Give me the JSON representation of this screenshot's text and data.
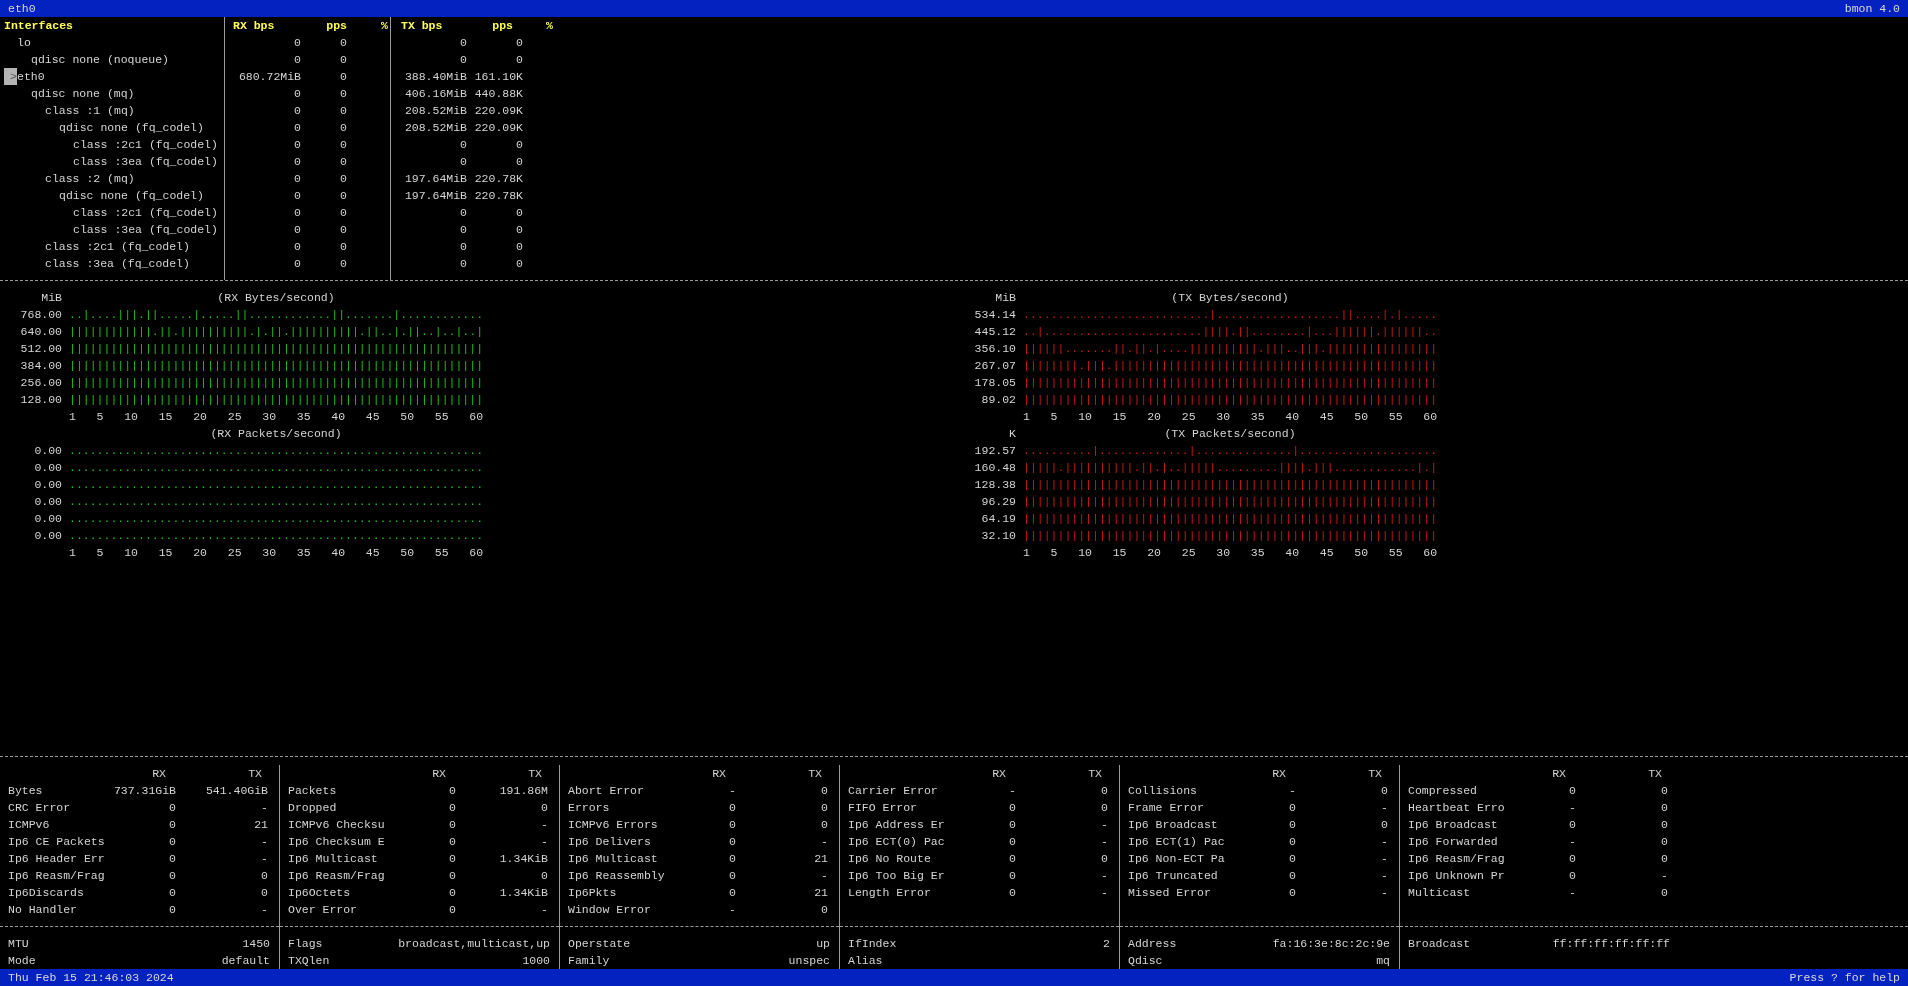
{
  "title_bar": {
    "left": "eth0",
    "right": "bmon 4.0"
  },
  "interfaces": {
    "columns": [
      "Interfaces",
      "RX bps",
      "pps",
      "%",
      "TX bps",
      "pps",
      "%"
    ],
    "cursor": ">",
    "rows": [
      {
        "name": "lo",
        "rx_bps": "0",
        "rx_pps": "0",
        "tx_bps": "0",
        "tx_pps": "0",
        "selected": false,
        "children": [
          {
            "name": "qdisc none (noqueue)",
            "rx_bps": "0",
            "rx_pps": "0",
            "tx_bps": "0",
            "tx_pps": "0"
          }
        ]
      },
      {
        "name": "eth0",
        "rx_bps": "680.72MiB",
        "rx_pps": "0",
        "tx_bps": "388.40MiB",
        "tx_pps": "161.10K",
        "selected": true,
        "children": [
          {
            "name": "qdisc none (mq)",
            "rx_bps": "0",
            "rx_pps": "0",
            "tx_bps": "406.16MiB",
            "tx_pps": "440.88K",
            "children": [
              {
                "name": "class :1 (mq)",
                "rx_bps": "0",
                "rx_pps": "0",
                "tx_bps": "208.52MiB",
                "tx_pps": "220.09K",
                "children": [
                  {
                    "name": "qdisc none (fq_codel)",
                    "rx_bps": "0",
                    "rx_pps": "0",
                    "tx_bps": "208.52MiB",
                    "tx_pps": "220.09K",
                    "children": [
                      {
                        "name": "class :2c1 (fq_codel)",
                        "rx_bps": "0",
                        "rx_pps": "0",
                        "tx_bps": "0",
                        "tx_pps": "0"
                      },
                      {
                        "name": "class :3ea (fq_codel)",
                        "rx_bps": "0",
                        "rx_pps": "0",
                        "tx_bps": "0",
                        "tx_pps": "0"
                      }
                    ]
                  }
                ]
              },
              {
                "name": "class :2 (mq)",
                "rx_bps": "0",
                "rx_pps": "0",
                "tx_bps": "197.64MiB",
                "tx_pps": "220.78K",
                "children": [
                  {
                    "name": "qdisc none (fq_codel)",
                    "rx_bps": "0",
                    "rx_pps": "0",
                    "tx_bps": "197.64MiB",
                    "tx_pps": "220.78K",
                    "children": [
                      {
                        "name": "class :2c1 (fq_codel)",
                        "rx_bps": "0",
                        "rx_pps": "0",
                        "tx_bps": "0",
                        "tx_pps": "0"
                      },
                      {
                        "name": "class :3ea (fq_codel)",
                        "rx_bps": "0",
                        "rx_pps": "0",
                        "tx_bps": "0",
                        "tx_pps": "0"
                      }
                    ]
                  }
                ]
              },
              {
                "name": "class :2c1 (fq_codel)",
                "rx_bps": "0",
                "rx_pps": "0",
                "tx_bps": "0",
                "tx_pps": "0"
              },
              {
                "name": "class :3ea (fq_codel)",
                "rx_bps": "0",
                "rx_pps": "0",
                "tx_bps": "0",
                "tx_pps": "0"
              }
            ]
          }
        ]
      }
    ]
  },
  "graph_columns": [
    [
      {
        "unit": "MiB",
        "title": "(RX Bytes/second)",
        "color": "#1ec01e",
        "axis": "1   5   10   15   20   25   30   35   40   45   50   55   60",
        "rows": [
          {
            "label": "768.00",
            "pattern": "..|....|||.||.....|.....||............||.......|............"
          },
          {
            "label": "640.00",
            "pattern": "||||||||||||.||.||||||||||.|.||.||||||||||.||..|.||..|..|..|"
          },
          {
            "label": "512.00",
            "pattern": "||||||||||||||||||||||||||||||||||||||||||||||||||||||||||||"
          },
          {
            "label": "384.00",
            "pattern": "||||||||||||||||||||||||||||||||||||||||||||||||||||||||||||"
          },
          {
            "label": "256.00",
            "pattern": "||||||||||||||||||||||||||||||||||||||||||||||||||||||||||||"
          },
          {
            "label": "128.00",
            "pattern": "||||||||||||||||||||||||||||||||||||||||||||||||||||||||||||"
          }
        ]
      },
      {
        "title": "(RX Packets/second)",
        "color": "#1ec01e",
        "axis": "1   5   10   15   20   25   30   35   40   45   50   55   60",
        "rows": [
          {
            "label": "0.00",
            "pattern": "............................................................"
          },
          {
            "label": "0.00",
            "pattern": "............................................................"
          },
          {
            "label": "0.00",
            "pattern": "............................................................"
          },
          {
            "label": "0.00",
            "pattern": "............................................................"
          },
          {
            "label": "0.00",
            "pattern": "............................................................"
          },
          {
            "label": "0.00",
            "pattern": "............................................................"
          }
        ]
      }
    ],
    [
      {
        "unit": "MiB",
        "title": "(TX Bytes/second)",
        "color": "#d01818",
        "axis": "1   5   10   15   20   25   30   35   40   45   50   55   60",
        "rows": [
          {
            "label": "534.14",
            "pattern": "...........................|..................||....|.|....."
          },
          {
            "label": "445.12",
            "pattern": "..|.......................||||.||........|...||||||.||||||.."
          },
          {
            "label": "356.10",
            "pattern": "||||||.......||.||.|....||||||||||.|||..|||.||||||||||||||||"
          },
          {
            "label": "267.07",
            "pattern": "||||||||.|||.|||||||||||||||||||||||||||||||||||||||||||||||"
          },
          {
            "label": "178.05",
            "pattern": "||||||||||||||||||||||||||||||||||||||||||||||||||||||||||||"
          },
          {
            "label": "89.02",
            "pattern": "||||||||||||||||||||||||||||||||||||||||||||||||||||||||||||"
          }
        ]
      },
      {
        "unit": "K",
        "title": "(TX Packets/second)",
        "color": "#d01818",
        "axis": "1   5   10   15   20   25   30   35   40   45   50   55   60",
        "rows": [
          {
            "label": "192.57",
            "pattern": "..........|.............|..............|...................."
          },
          {
            "label": "160.48",
            "pattern": "|||||.||||||||||.||.|..|||||.........||||.|||............|.|"
          },
          {
            "label": "128.38",
            "pattern": "||||||||||||||||||||||||||||||||||||||||||||||||||||||||||||"
          },
          {
            "label": "96.29",
            "pattern": "||||||||||||||||||||||||||||||||||||||||||||||||||||||||||||"
          },
          {
            "label": "64.19",
            "pattern": "||||||||||||||||||||||||||||||||||||||||||||||||||||||||||||"
          },
          {
            "label": "32.10",
            "pattern": "||||||||||||||||||||||||||||||||||||||||||||||||||||||||||||"
          }
        ]
      }
    ]
  ],
  "stats": [
    {
      "rx_header": "RX",
      "tx_header": "TX",
      "rows": [
        {
          "label": "Bytes",
          "rx": "737.31GiB",
          "tx": "541.40GiB"
        },
        {
          "label": "CRC Error",
          "rx": "0",
          "tx": "-"
        },
        {
          "label": "ICMPv6",
          "rx": "0",
          "tx": "21"
        },
        {
          "label": "Ip6 CE Packets",
          "rx": "0",
          "tx": "-"
        },
        {
          "label": "Ip6 Header Err",
          "rx": "0",
          "tx": "-"
        },
        {
          "label": "Ip6 Reasm/Frag",
          "rx": "0",
          "tx": "0"
        },
        {
          "label": "Ip6Discards",
          "rx": "0",
          "tx": "0"
        },
        {
          "label": "No Handler",
          "rx": "0",
          "tx": "-"
        }
      ]
    },
    {
      "rx_header": "RX",
      "tx_header": "TX",
      "rows": [
        {
          "label": "Packets",
          "rx": "0",
          "tx": "191.86M"
        },
        {
          "label": "Dropped",
          "rx": "0",
          "tx": "0"
        },
        {
          "label": "ICMPv6 Checksu",
          "rx": "0",
          "tx": "-"
        },
        {
          "label": "Ip6 Checksum E",
          "rx": "0",
          "tx": "-"
        },
        {
          "label": "Ip6 Multicast",
          "rx": "0",
          "tx": "1.34KiB"
        },
        {
          "label": "Ip6 Reasm/Frag",
          "rx": "0",
          "tx": "0"
        },
        {
          "label": "Ip6Octets",
          "rx": "0",
          "tx": "1.34KiB"
        },
        {
          "label": "Over Error",
          "rx": "0",
          "tx": "-"
        }
      ]
    },
    {
      "rx_header": "RX",
      "tx_header": "TX",
      "rows": [
        {
          "label": "Abort Error",
          "rx": "-",
          "tx": "0"
        },
        {
          "label": "Errors",
          "rx": "0",
          "tx": "0"
        },
        {
          "label": "ICMPv6 Errors",
          "rx": "0",
          "tx": "0"
        },
        {
          "label": "Ip6 Delivers",
          "rx": "0",
          "tx": "-"
        },
        {
          "label": "Ip6 Multicast",
          "rx": "0",
          "tx": "21"
        },
        {
          "label": "Ip6 Reassembly",
          "rx": "0",
          "tx": "-"
        },
        {
          "label": "Ip6Pkts",
          "rx": "0",
          "tx": "21"
        },
        {
          "label": "Window Error",
          "rx": "-",
          "tx": "0"
        }
      ]
    },
    {
      "rx_header": "RX",
      "tx_header": "TX",
      "rows": [
        {
          "label": "Carrier Error",
          "rx": "-",
          "tx": "0"
        },
        {
          "label": "FIFO Error",
          "rx": "0",
          "tx": "0"
        },
        {
          "label": "Ip6 Address Er",
          "rx": "0",
          "tx": "-"
        },
        {
          "label": "Ip6 ECT(0) Pac",
          "rx": "0",
          "tx": "-"
        },
        {
          "label": "Ip6 No Route",
          "rx": "0",
          "tx": "0"
        },
        {
          "label": "Ip6 Too Big Er",
          "rx": "0",
          "tx": "-"
        },
        {
          "label": "Length Error",
          "rx": "0",
          "tx": "-"
        }
      ]
    },
    {
      "rx_header": "RX",
      "tx_header": "TX",
      "rows": [
        {
          "label": "Collisions",
          "rx": "-",
          "tx": "0"
        },
        {
          "label": "Frame Error",
          "rx": "0",
          "tx": "-"
        },
        {
          "label": "Ip6 Broadcast",
          "rx": "0",
          "tx": "0"
        },
        {
          "label": "Ip6 ECT(1) Pac",
          "rx": "0",
          "tx": "-"
        },
        {
          "label": "Ip6 Non-ECT Pa",
          "rx": "0",
          "tx": "-"
        },
        {
          "label": "Ip6 Truncated",
          "rx": "0",
          "tx": "-"
        },
        {
          "label": "Missed Error",
          "rx": "0",
          "tx": "-"
        }
      ]
    },
    {
      "rx_header": "RX",
      "tx_header": "TX",
      "rows": [
        {
          "label": "Compressed",
          "rx": "0",
          "tx": "0"
        },
        {
          "label": "Heartbeat Erro",
          "rx": "-",
          "tx": "0"
        },
        {
          "label": "Ip6 Broadcast",
          "rx": "0",
          "tx": "0"
        },
        {
          "label": "Ip6 Forwarded",
          "rx": "-",
          "tx": "0"
        },
        {
          "label": "Ip6 Reasm/Frag",
          "rx": "0",
          "tx": "0"
        },
        {
          "label": "Ip6 Unknown Pr",
          "rx": "0",
          "tx": "-"
        },
        {
          "label": "Multicast",
          "rx": "-",
          "tx": "0"
        }
      ]
    }
  ],
  "info": [
    [
      {
        "label": "MTU",
        "value": "1450"
      },
      {
        "label": "Mode",
        "value": "default"
      }
    ],
    [
      {
        "label": "Flags",
        "value": "broadcast,multicast,up"
      },
      {
        "label": "TXQlen",
        "value": "1000"
      }
    ],
    [
      {
        "label": "Operstate",
        "value": "up"
      },
      {
        "label": "Family",
        "value": "unspec"
      }
    ],
    [
      {
        "label": "IfIndex",
        "value": "2"
      },
      {
        "label": "Alias"
      }
    ],
    [
      {
        "label": "Address",
        "value": "fa:16:3e:8c:2c:9e"
      },
      {
        "label": "Qdisc",
        "value": "mq"
      }
    ],
    [
      {
        "label": "Broadcast",
        "value": "ff:ff:ff:ff:ff:ff"
      }
    ]
  ],
  "status_bar": {
    "left": "Thu Feb 15 21:46:03 2024",
    "right": "Press ? for help"
  }
}
